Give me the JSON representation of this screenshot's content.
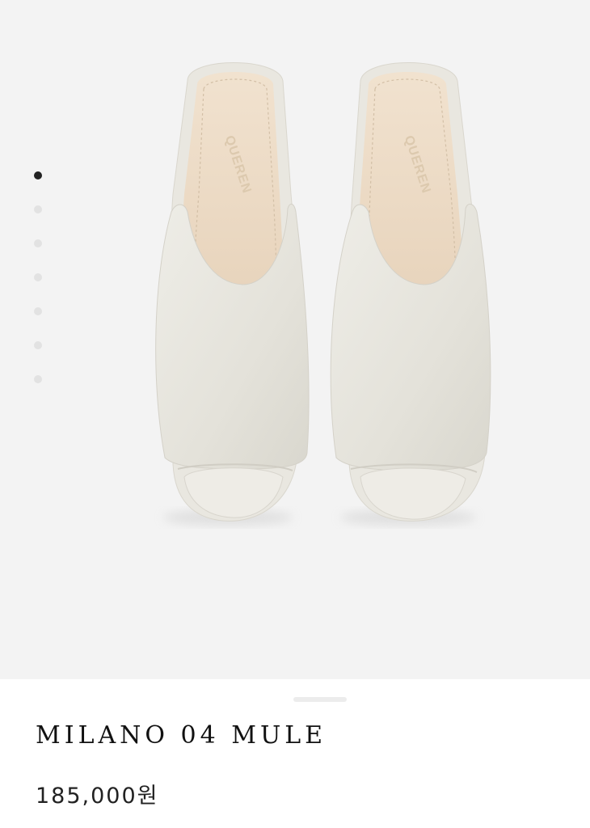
{
  "gallery": {
    "image_icon": "white-leather-mule-pair",
    "slide_count": 7,
    "active_slide": 1
  },
  "product": {
    "name": "MILANO 04 MULE",
    "price": "185,000원"
  },
  "colors": {
    "gallery_background": "#f3f3f3",
    "leather": "#e6e4dc",
    "insole": "#ecdcc6",
    "dot_active": "#222222",
    "dot_inactive": "#e2e2e2"
  }
}
